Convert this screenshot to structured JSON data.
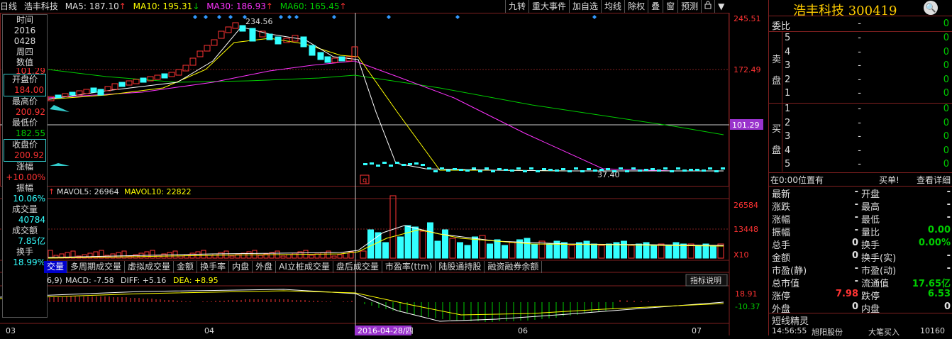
{
  "header": {
    "period": "日线",
    "stock": "浩丰科技",
    "ma5_label": "MA5: 187.10",
    "ma10_label": "MA10: 195.31",
    "ma30_label": "MA30: 186.93",
    "ma60_label": "MA60: 165.45"
  },
  "toolbar": [
    "九转",
    "重大事件",
    "加自选",
    "均线",
    "除权",
    "叠",
    "窗",
    "预测"
  ],
  "toolbar_icons": [
    "lock-icon",
    "chevron-down-icon"
  ],
  "infobox": {
    "time_label": "时间",
    "year": "2016",
    "date": "0428",
    "weekday": "周四",
    "value_label": "数值",
    "value": "101.29",
    "open_label": "开盘价",
    "open": "184.00",
    "high_label": "最高价",
    "high": "200.92",
    "low_label": "最低价",
    "low": "182.55",
    "close_label": "收盘价",
    "close": "200.92",
    "chg_label": "涨幅",
    "chg": "+10.00%",
    "amp_label": "振幅",
    "amp": "10.06%",
    "vol_label": "成交量",
    "vol": "40784",
    "amt_label": "成交额",
    "amt": "7.85亿",
    "turn_label": "换手",
    "turn": "18.99%"
  },
  "price_axis": [
    "245.51",
    "172.49",
    "101.29",
    "26584",
    "13448",
    "X10",
    "18.91",
    "-10.37"
  ],
  "annotations": {
    "high": "234.56",
    "low": "37.40",
    "q_marker": "q"
  },
  "volume_header": {
    "mavol5": "MAVOL5: 26964",
    "mavol10": "MAVOL10: 22822"
  },
  "macd_header": {
    "params": "6,9)",
    "macd": "MACD: -7.58",
    "diff": "DIFF: +5.16",
    "dea": "DEA: +8.95",
    "help": "指标说明"
  },
  "tabs": [
    "交量",
    "多周期成交量",
    "虚拟成交量",
    "金额",
    "换手率",
    "内盘",
    "外盘",
    "AI立桩成交量",
    "盘后成交量",
    "市盈率(ttm)",
    "陆股通持股",
    "融资融券余额"
  ],
  "xaxis": {
    "m03": "03",
    "m04": "04",
    "sel_date": "2016-04-28/四",
    "m06": "06",
    "m07": "07"
  },
  "right_panel": {
    "title": "浩丰科技 300419",
    "weibi_label": "委比",
    "weibi": "-",
    "weibi_val": "0",
    "sell_label": "卖盘",
    "sell": [
      [
        "5",
        "-",
        "0"
      ],
      [
        "4",
        "-",
        "0"
      ],
      [
        "3",
        "-",
        "0"
      ],
      [
        "2",
        "-",
        "0"
      ],
      [
        "1",
        "-",
        "0"
      ]
    ],
    "buy_label": "买盘",
    "buy": [
      [
        "1",
        "-",
        "0"
      ],
      [
        "2",
        "-",
        "0"
      ],
      [
        "3",
        "-",
        "0"
      ],
      [
        "4",
        "-",
        "0"
      ],
      [
        "5",
        "-",
        "0"
      ]
    ],
    "status": "在0:00位置有",
    "buy_single": "买单!",
    "detail_link": "查看详细",
    "quote": [
      [
        "最新",
        "-",
        "开盘",
        "-"
      ],
      [
        "涨跌",
        "-",
        "最高",
        "-"
      ],
      [
        "涨幅",
        "-",
        "最低",
        "-"
      ],
      [
        "振幅",
        "-",
        "量比",
        "0.00"
      ],
      [
        "总手",
        "0",
        "换手",
        "0.00%"
      ],
      [
        "金额",
        "0",
        "换手(实)",
        "-"
      ],
      [
        "市盈(静)",
        "-",
        "市盈(动)",
        "-"
      ],
      [
        "总市值",
        "-",
        "流通值",
        "17.65亿"
      ],
      [
        "涨停",
        "7.98",
        "跌停",
        "6.53"
      ],
      [
        "外盘",
        "0",
        "内盘",
        "0"
      ]
    ],
    "sprite": "短线精灵",
    "ticker_time": "14:56:55",
    "ticker_name": "旭阳股份",
    "ticker_event": "大笔买入",
    "ticker_vol": "10160"
  },
  "colors": {
    "up": "#ff3333",
    "down": "#00ffff",
    "ma5": "#ffffff",
    "ma10": "#ffff00",
    "ma30": "#ff33ff",
    "ma60": "#00cc00"
  }
}
